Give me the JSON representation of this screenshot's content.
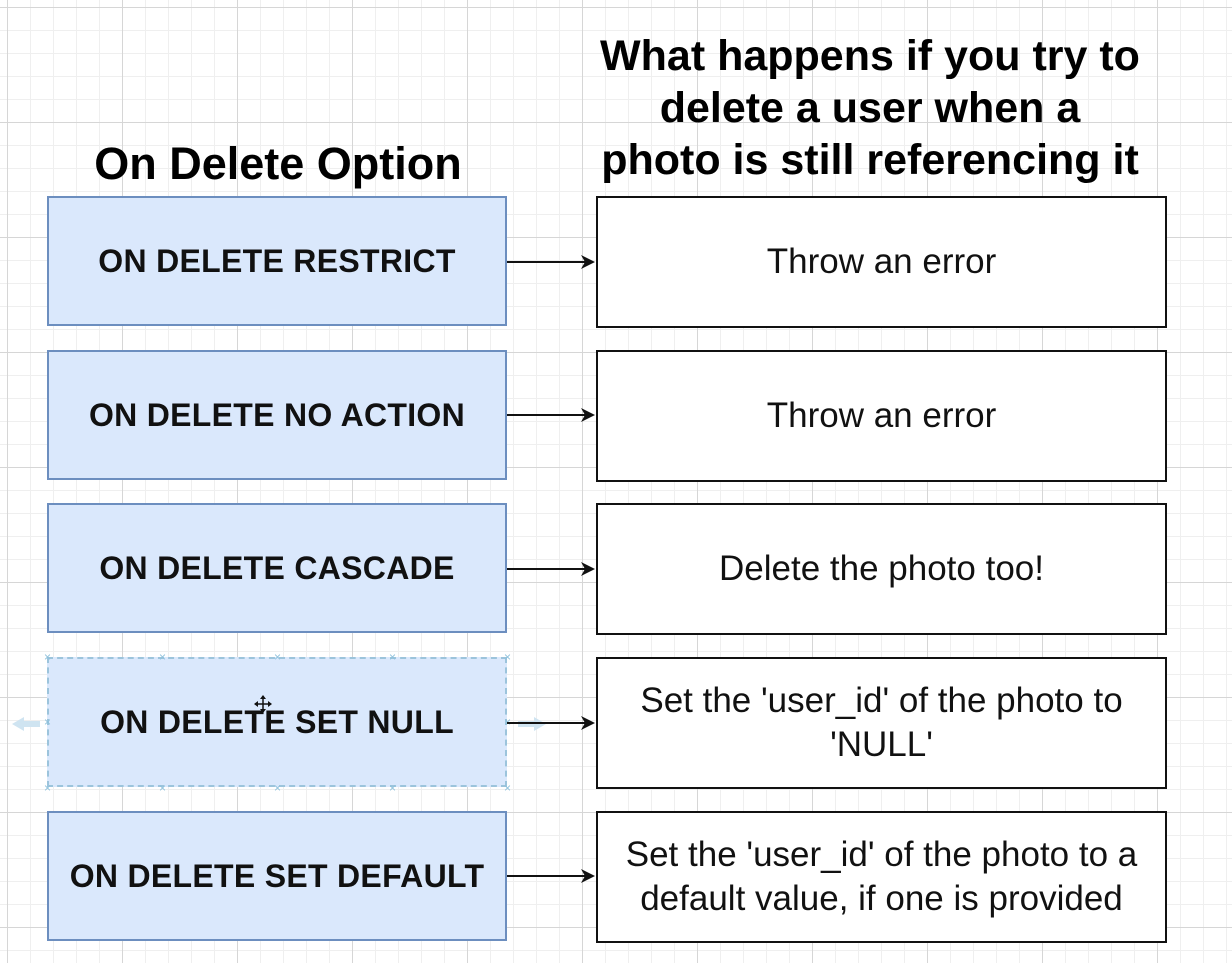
{
  "headings": {
    "left": "On Delete Option",
    "right_lines": [
      "What happens if you try to",
      "delete a user when a",
      "photo is still referencing it"
    ]
  },
  "rows": [
    {
      "option": "ON DELETE RESTRICT",
      "result_lines": [
        "Throw an error"
      ]
    },
    {
      "option": "ON DELETE NO ACTION",
      "result_lines": [
        "Throw an error"
      ]
    },
    {
      "option": "ON DELETE CASCADE",
      "result_lines": [
        "Delete the photo too!"
      ]
    },
    {
      "option": "ON DELETE SET NULL",
      "result_lines": [
        "Set the 'user_id' of the photo to",
        "'NULL'"
      ]
    },
    {
      "option": "ON DELETE SET DEFAULT",
      "result_lines": [
        "Set the 'user_id' of the photo to a",
        "default value, if one is provided"
      ]
    }
  ],
  "colors": {
    "option_fill": "#dae8fc",
    "option_stroke": "#6c8ebf",
    "result_stroke": "#111111",
    "selection": "#8ec1dc"
  },
  "icons": {
    "move": "move-cursor-icon",
    "arrow": "right-arrow-icon"
  }
}
